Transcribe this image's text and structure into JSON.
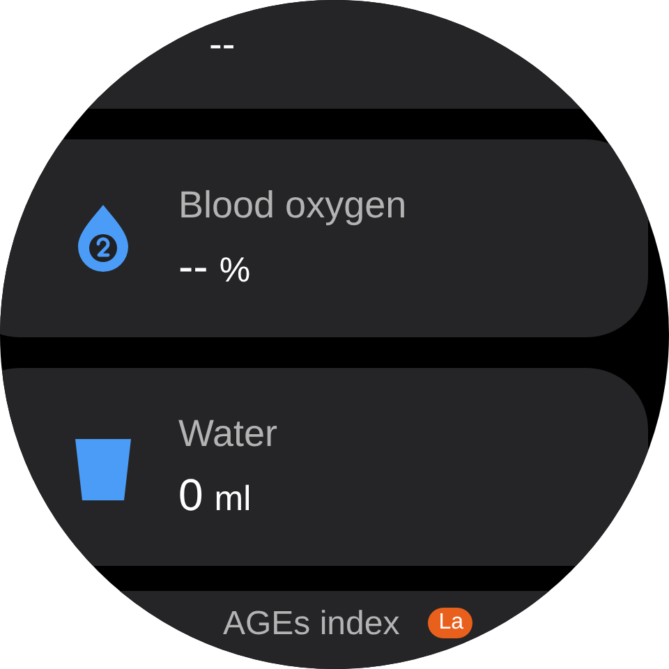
{
  "cards": [
    {
      "kind": "summary",
      "value": "--"
    },
    {
      "kind": "oxygen",
      "title": "Blood oxygen",
      "value": "--",
      "unit": "%"
    },
    {
      "kind": "water",
      "title": "Water",
      "value": "0",
      "unit": "ml"
    },
    {
      "kind": "index",
      "title": "AGEs index",
      "badge": "La"
    }
  ]
}
